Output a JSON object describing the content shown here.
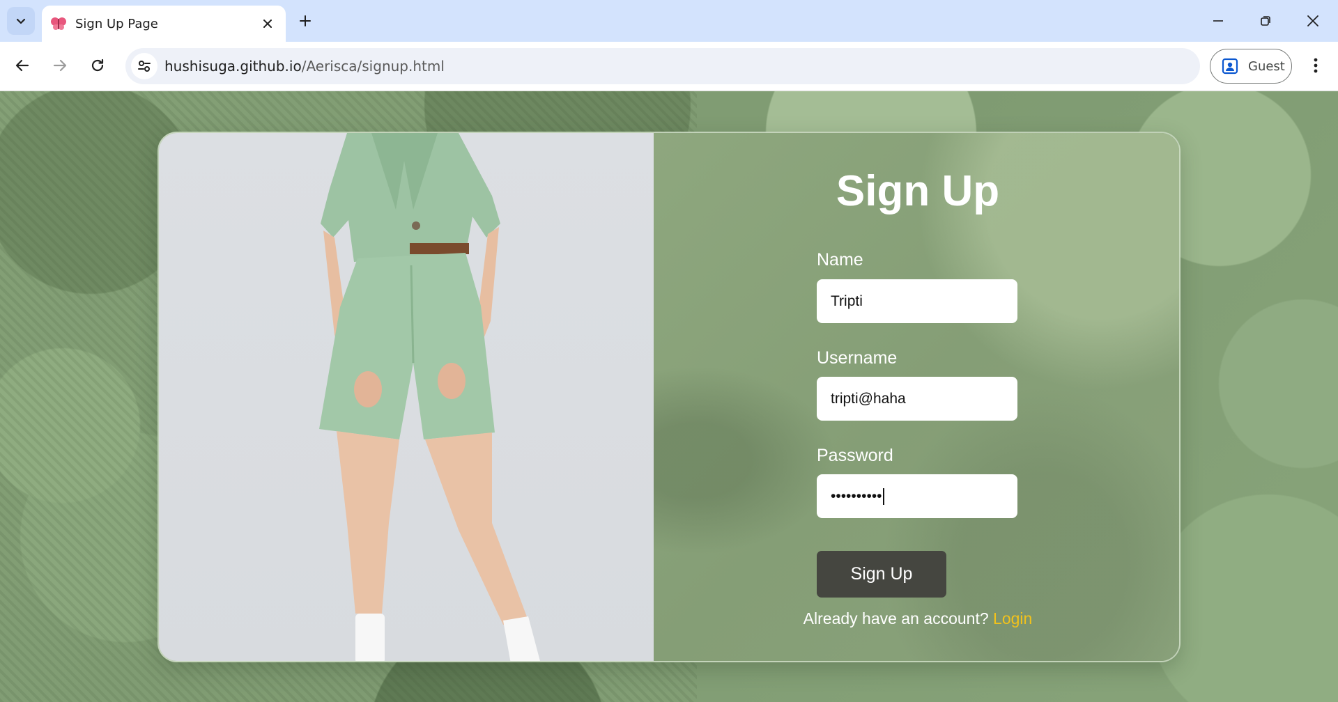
{
  "browser": {
    "tab": {
      "title": "Sign Up Page"
    },
    "url": {
      "host": "hushisuga.github.io",
      "path": "/Aerisca/signup.html"
    },
    "profile": {
      "label": "Guest"
    },
    "icons": {
      "tab_search": "chevron-down-icon",
      "favicon": "butterfly-icon",
      "tab_close": "close-icon",
      "new_tab": "plus-icon",
      "minimize": "minimize-icon",
      "restore": "restore-icon",
      "close": "close-icon",
      "back": "arrow-left-icon",
      "forward": "arrow-right-icon",
      "reload": "reload-icon",
      "site_info": "tune-icon",
      "profile": "person-icon",
      "menu": "more-vert-icon"
    }
  },
  "page": {
    "title": "Sign Up",
    "fields": {
      "name": {
        "label": "Name",
        "value": "Tripti"
      },
      "username": {
        "label": "Username",
        "value": "tripti@haha"
      },
      "password": {
        "label": "Password",
        "value": "••••••••••"
      }
    },
    "submit_label": "Sign Up",
    "login_prompt": "Already have an account?",
    "login_link": "Login",
    "colors": {
      "accent_link": "#f2c21b",
      "button": "#454640",
      "background": "#84a076"
    }
  }
}
